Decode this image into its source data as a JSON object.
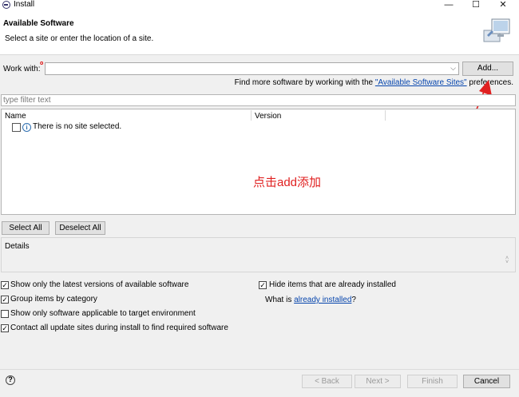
{
  "window": {
    "title": "Install",
    "minimize_glyph": "—",
    "maximize_glyph": "☐",
    "close_glyph": "✕"
  },
  "header": {
    "title": "Available Software",
    "subtitle": "Select a site or enter the location of a site."
  },
  "work_with": {
    "label": "Work with:",
    "required_marker": "o",
    "value": "",
    "combo_arrow": "⌵",
    "add_button": "Add..."
  },
  "find_more": {
    "prefix": "Find more software by working with the ",
    "link": "\"Available Software Sites\"",
    "suffix": " preferences."
  },
  "filter": {
    "placeholder": "type filter text"
  },
  "table": {
    "columns": [
      "Name",
      "Version"
    ],
    "rows": [
      {
        "message": "There is no site selected."
      }
    ],
    "info_icon_glyph": "i"
  },
  "annotation": {
    "text": "点击add添加",
    "color": "#e02020"
  },
  "selection_buttons": {
    "select_all": "Select All",
    "deselect_all": "Deselect All"
  },
  "details": {
    "label": "Details"
  },
  "options": {
    "show_latest": {
      "label": "Show only the latest versions of available software",
      "checked": true
    },
    "group_by_category": {
      "label": "Group items by category",
      "checked": true
    },
    "target_env": {
      "label": "Show only software applicable to target environment",
      "checked": false
    },
    "contact_sites": {
      "label": "Contact all update sites during install to find required software",
      "checked": true
    },
    "hide_installed": {
      "label": "Hide items that are already installed",
      "checked": true
    },
    "what_is": {
      "prefix": "What is ",
      "link": "already installed",
      "suffix": "?"
    }
  },
  "footer": {
    "help_glyph": "?",
    "back": "< Back",
    "next": "Next >",
    "finish": "Finish",
    "cancel": "Cancel"
  },
  "check_glyph": "✓"
}
